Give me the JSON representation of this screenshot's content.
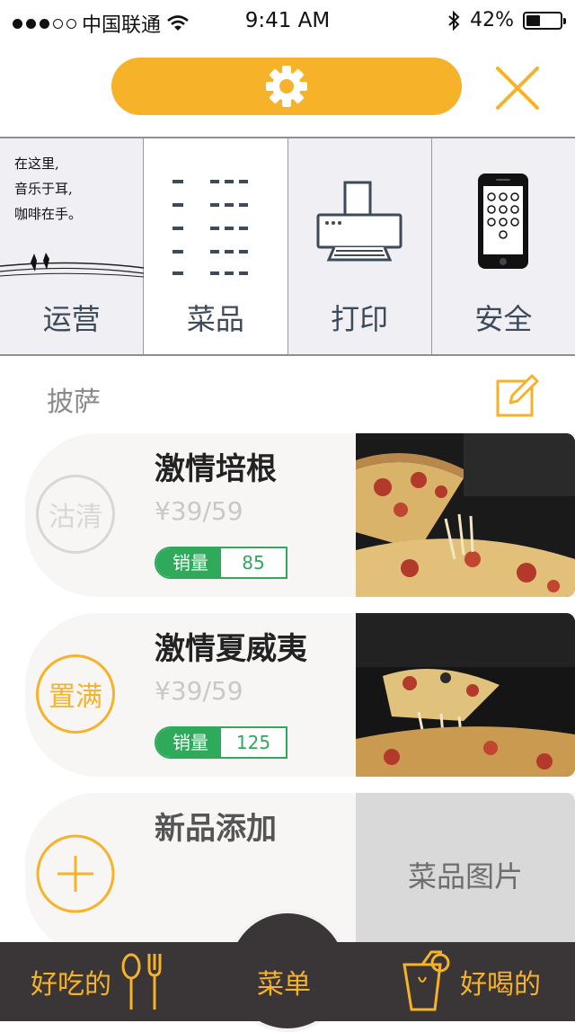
{
  "status_bar": {
    "carrier": "中国联通",
    "time": "9:41 AM",
    "battery": "42%",
    "battery_level": 0.42
  },
  "header": {
    "settings_icon": "gear-icon",
    "close_icon": "close-icon",
    "accent": "#f6b228"
  },
  "tabs": [
    {
      "label": "运营",
      "poem": [
        "在这里,",
        "音乐于耳,",
        "咖啡在手。"
      ],
      "active": false
    },
    {
      "label": "菜品",
      "active": true
    },
    {
      "label": "打印",
      "active": false
    },
    {
      "label": "安全",
      "active": false
    }
  ],
  "section": {
    "title": "披萨",
    "edit_icon": "edit-icon"
  },
  "dishes": [
    {
      "stamp": "沽清",
      "stamp_color": "#d7d7d7",
      "name": "激情培根",
      "price": "¥39/59",
      "sales_label": "销量",
      "sales": "85"
    },
    {
      "stamp": "置满",
      "stamp_color": "#f6b228",
      "name": "激情夏威夷",
      "price": "¥39/59",
      "sales_label": "销量",
      "sales": "125"
    }
  ],
  "new_dish": {
    "title": "新品添加",
    "image_placeholder": "菜品图片",
    "add_icon": "plus-icon"
  },
  "bottom_nav": {
    "left": "好吃的",
    "center": "菜单",
    "right": "好喝的"
  }
}
